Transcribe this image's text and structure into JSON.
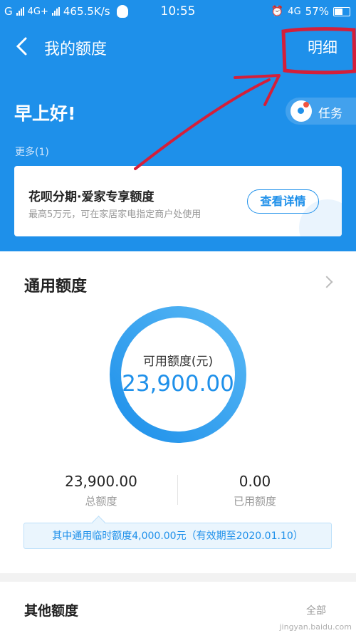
{
  "status_bar": {
    "left_network": "G",
    "left_net2": "4G+",
    "speed": "465.5K/s",
    "time": "10:55",
    "right_net": "4G",
    "battery": "57%"
  },
  "nav": {
    "title": "我的额度",
    "detail_label": "明细"
  },
  "header": {
    "greeting": "早上好!",
    "task_label": "任务",
    "more_label": "更多(1)"
  },
  "promo": {
    "title": "花呗分期·爱家专享额度",
    "subtitle": "最高5万元，可在家居家电指定商户处使用",
    "button": "查看详情"
  },
  "quota": {
    "title": "通用额度",
    "available_label": "可用额度(元)",
    "available_value": "23,900.00",
    "available_fraction": 1.0,
    "total_value": "23,900.00",
    "total_label": "总额度",
    "used_value": "0.00",
    "used_label": "已用额度",
    "temp_note": "其中通用临时额度4,000.00元（有效期至2020.01.10）"
  },
  "other": {
    "title": "其他额度",
    "right_text": "全部"
  },
  "watermark": "jingyan.baidu.com",
  "colors": {
    "primary": "#1e90ea",
    "annotation": "#d41f3a"
  }
}
